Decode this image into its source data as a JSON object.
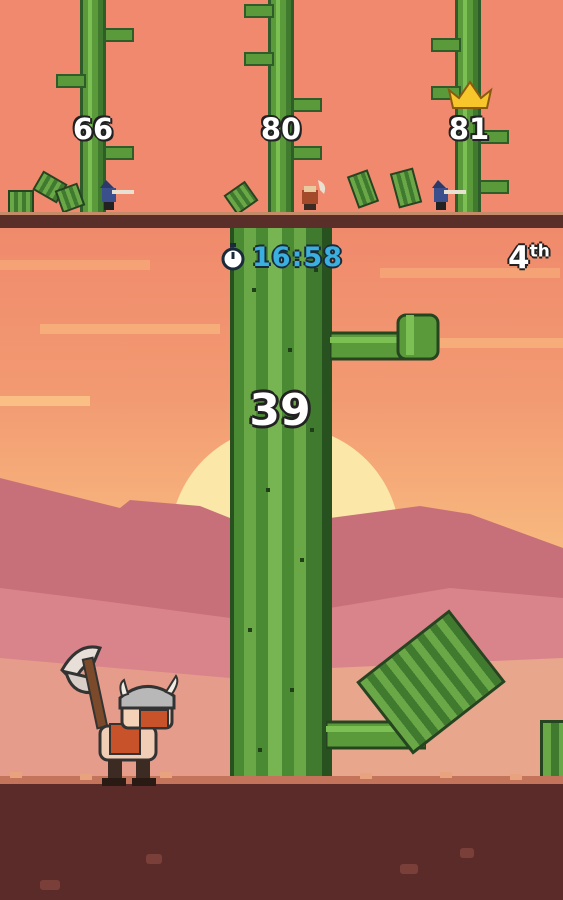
{
  "opponents": [
    {
      "score": "66",
      "leader": false
    },
    {
      "score": "80",
      "leader": false
    },
    {
      "score": "81",
      "leader": true
    }
  ],
  "hud": {
    "timer": "16:58",
    "rank_number": "4",
    "rank_suffix": "th",
    "score": "39"
  },
  "icons": {
    "timer": "stopwatch-icon",
    "leader": "crown-icon"
  },
  "colors": {
    "timer_text": "#3ab0e0",
    "sky": "#f08a6c",
    "cactus": "#4a8a33",
    "ground": "#5b2b2a"
  }
}
